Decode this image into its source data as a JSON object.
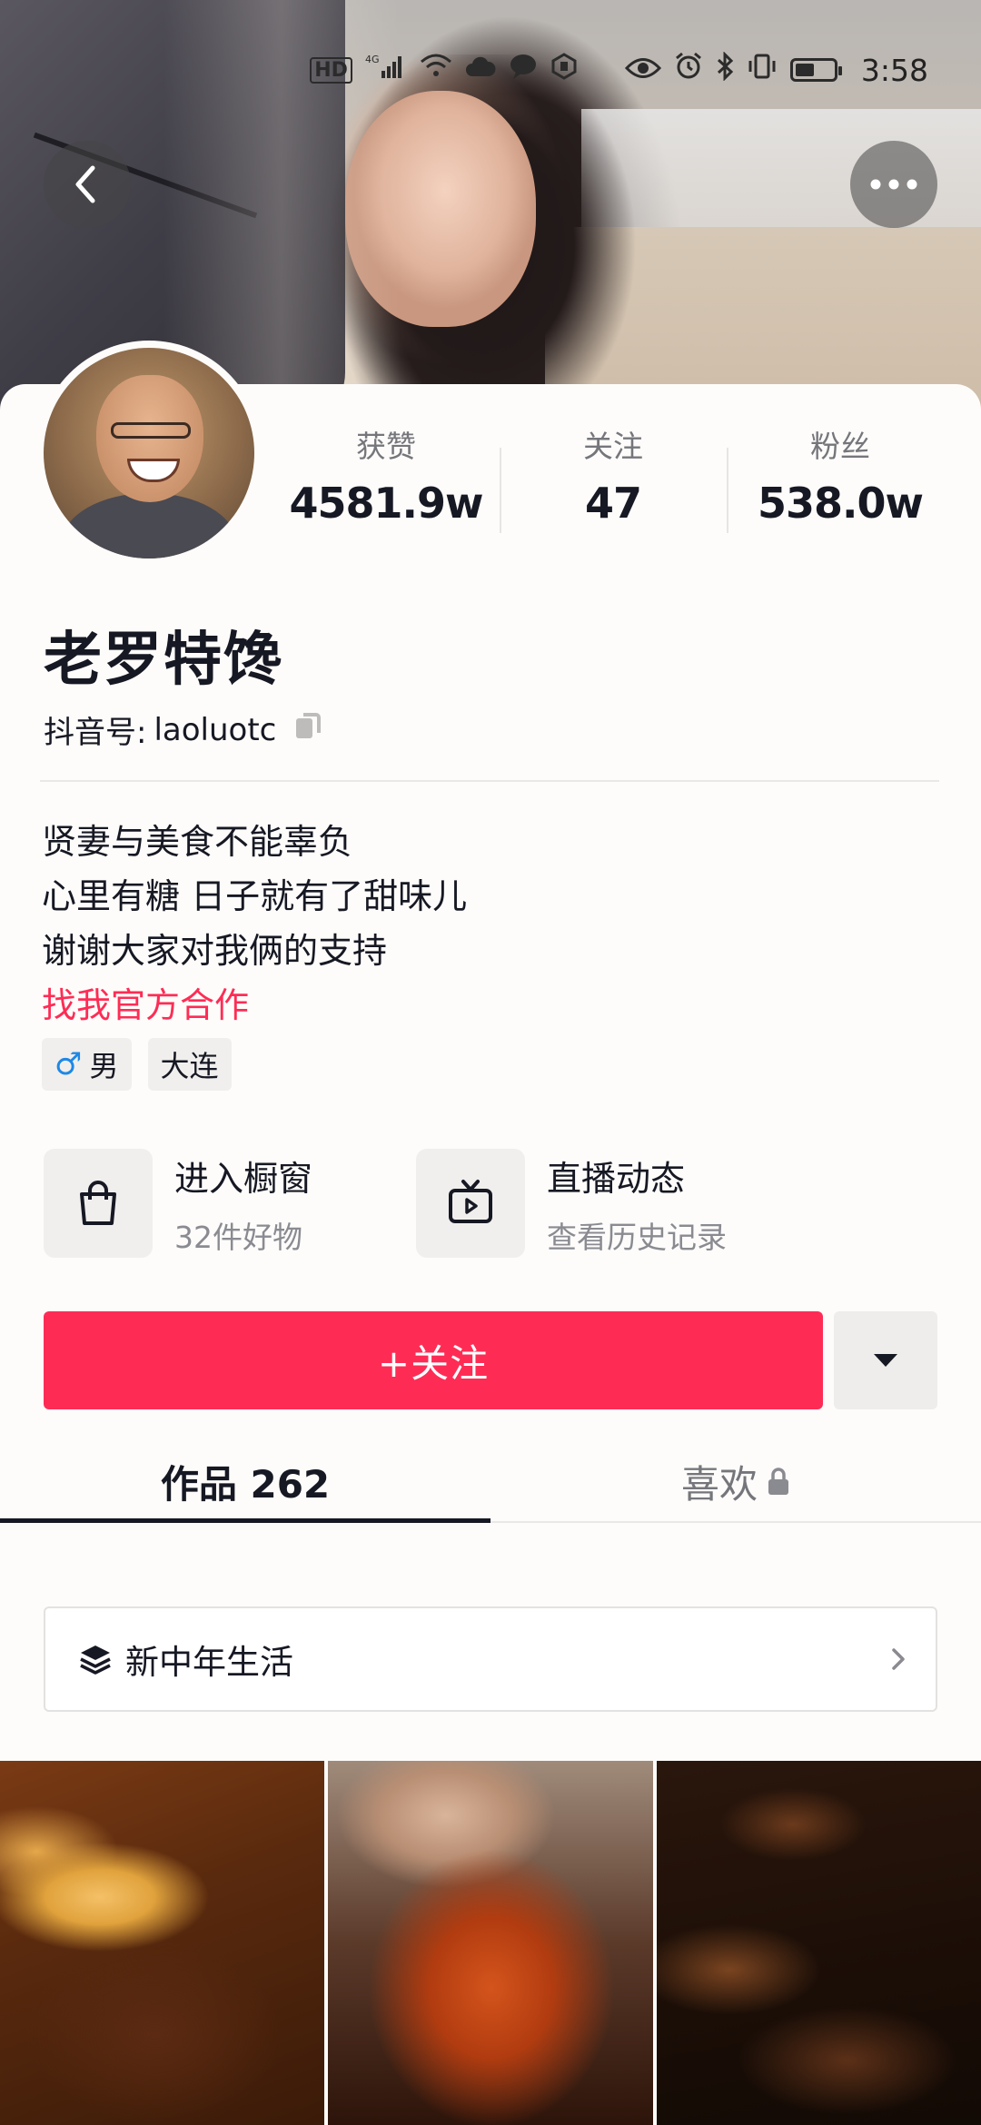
{
  "status_bar": {
    "hd": "HD",
    "net": "4G",
    "time": "3:58"
  },
  "header": {
    "back_icon": "chevron-left-icon",
    "more_icon": "more-dots-icon"
  },
  "profile": {
    "name": "老罗特馋",
    "douyin_id_label": "抖音号:",
    "douyin_id": "laoluotc",
    "stats": [
      {
        "label": "获赞",
        "value": "4581.9w"
      },
      {
        "label": "关注",
        "value": "47"
      },
      {
        "label": "粉丝",
        "value": "538.0w"
      }
    ],
    "bio_lines": [
      "贤妻与美食不能辜负",
      "心里有糖 日子就有了甜味儿",
      "谢谢大家对我俩的支持"
    ],
    "bio_link": "找我官方合作",
    "tags": {
      "gender_symbol": "♂",
      "gender": "男",
      "location": "大连"
    }
  },
  "entries": [
    {
      "title": "进入橱窗",
      "subtitle": "32件好物",
      "icon": "shopping-bag-icon"
    },
    {
      "title": "直播动态",
      "subtitle": "查看历史记录",
      "icon": "live-tv-icon"
    }
  ],
  "actions": {
    "follow_label": "+关注",
    "dropdown_icon": "caret-down-icon"
  },
  "tabs": [
    {
      "label": "作品 262",
      "active": true
    },
    {
      "label": "喜欢",
      "active": false,
      "icon": "lock-icon"
    }
  ],
  "collection": {
    "label": "新中年生活",
    "icon": "layers-icon"
  },
  "videos": [
    {
      "thumb": "braised-dish"
    },
    {
      "thumb": "glazed-meat"
    },
    {
      "thumb": "dark-stew"
    }
  ],
  "colors": {
    "accent": "#fe2c55",
    "text": "#161823",
    "muted": "#75767b"
  }
}
